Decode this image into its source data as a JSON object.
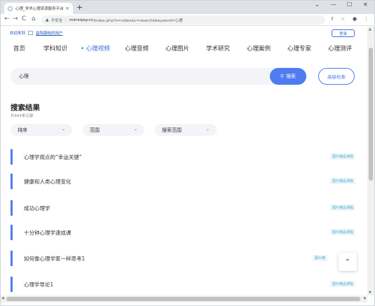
{
  "browser": {
    "tab_title": "心理_学术心理资源服务平台",
    "tab_close": "×",
    "new_tab": "+",
    "window_controls": [
      "⌄",
      "—",
      "☐",
      "✕"
    ],
    "nav": {
      "back": "←",
      "forward": "→",
      "reload": "C",
      "home": "⌂"
    },
    "security_label": "不安全",
    "url_host": "mirrorpsy.cn",
    "url_path": "/index.php?s=video&c=search&keyword=心理",
    "toolbar_icons": [
      "share-icon",
      "star-icon",
      "profile-icon",
      "menu-icon"
    ]
  },
  "header": {
    "welcome": "欢迎来到",
    "org_link": "益阳康柏的用户",
    "login_label": "登录"
  },
  "nav": {
    "items": [
      {
        "label": "首页",
        "active": false
      },
      {
        "label": "学科知识",
        "active": false
      },
      {
        "label": "心理视频",
        "active": true
      },
      {
        "label": "心理音频",
        "active": false
      },
      {
        "label": "心理图片",
        "active": false
      },
      {
        "label": "学术研究",
        "active": false
      },
      {
        "label": "心理案例",
        "active": false
      },
      {
        "label": "心理专家",
        "active": false
      },
      {
        "label": "心理测评",
        "active": false
      }
    ]
  },
  "search": {
    "value": "心理",
    "button_label": "搜索",
    "advanced_label": "高级检索"
  },
  "results": {
    "title": "搜索结果",
    "count_text": "共464条记录",
    "filters": [
      {
        "label": "排序"
      },
      {
        "label": "范围"
      },
      {
        "label": "搜索范围"
      }
    ],
    "items": [
      {
        "title": "心理学观点的“幸运关键”",
        "badge": "图片精品课程"
      },
      {
        "title": "健康和人类心理变化",
        "badge": "图片精品课程"
      },
      {
        "title": "成功心理学",
        "badge": "图片精品课程"
      },
      {
        "title": "十分钟心理学速成课",
        "badge": "图片精品课程"
      },
      {
        "title": "如何像心理学家一样思考1",
        "badge": "图片精"
      },
      {
        "title": "心理学导论1",
        "badge": "图片精品课程"
      }
    ]
  },
  "back_to_top": "⌃",
  "colors": {
    "accent": "#4e7cf0",
    "badge_text": "#4fb3c8"
  }
}
